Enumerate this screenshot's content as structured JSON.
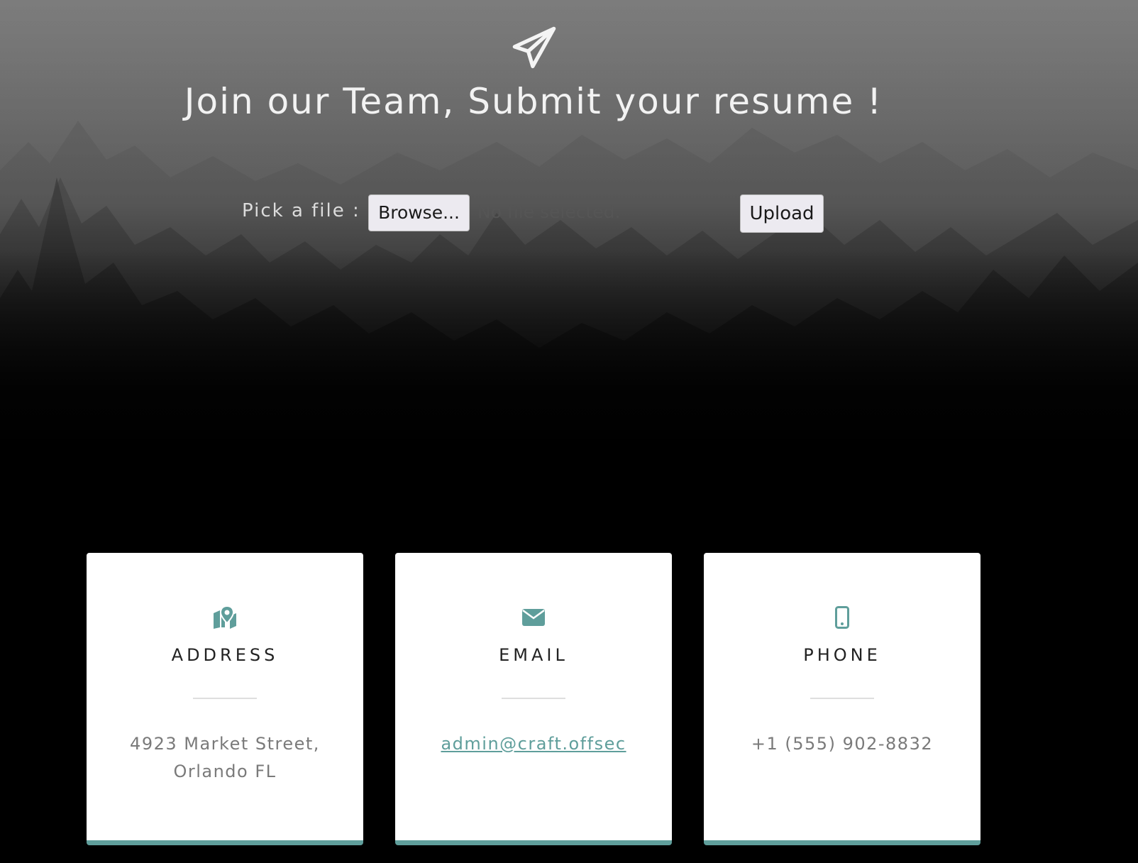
{
  "hero": {
    "title": "Join our Team, Submit your resume !",
    "icon": "paper-plane-icon"
  },
  "upload_form": {
    "label": "Pick a file :",
    "browse_label": "Browse...",
    "file_status": "No file selected.",
    "upload_label": "Upload"
  },
  "contact": {
    "accent_color": "#5f9e9b",
    "cards": [
      {
        "icon": "map-marker-icon",
        "title": "ADDRESS",
        "line1": "4923 Market Street,",
        "line2": "Orlando FL"
      },
      {
        "icon": "envelope-icon",
        "title": "EMAIL",
        "line1": "admin@craft.offsec"
      },
      {
        "icon": "mobile-phone-icon",
        "title": "PHONE",
        "line1": "+1 (555) 902-8832"
      }
    ]
  }
}
